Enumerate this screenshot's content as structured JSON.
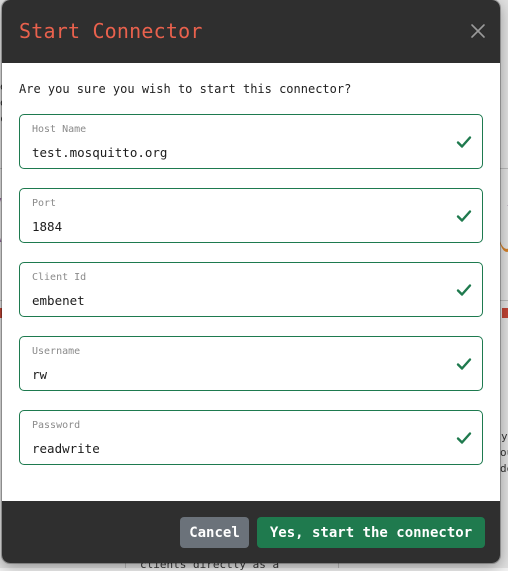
{
  "background": {
    "fragments": [
      "e",
      "e",
      "c",
      "y",
      "ou",
      "de",
      "clients directly as a"
    ]
  },
  "dialog": {
    "title": "Start Connector",
    "question": "Are you sure you wish to start this connector?",
    "fields": [
      {
        "label": "Host Name",
        "value": "test.mosquitto.org",
        "valid": true
      },
      {
        "label": "Port",
        "value": "1884",
        "valid": true
      },
      {
        "label": "Client Id",
        "value": "embenet",
        "valid": true
      },
      {
        "label": "Username",
        "value": "rw",
        "valid": true
      },
      {
        "label": "Password",
        "value": "readwrite",
        "valid": true
      }
    ],
    "cancel_label": "Cancel",
    "confirm_label": "Yes, start the connector"
  },
  "colors": {
    "title": "#e9614d",
    "header_bg": "#2f2f2f",
    "valid_border": "#1e7a4f",
    "check": "#1f7a4e",
    "cancel_bg": "#6b727a",
    "confirm_bg": "#1f7a4e"
  },
  "icons": {
    "close": "close-icon",
    "valid": "check-icon"
  }
}
